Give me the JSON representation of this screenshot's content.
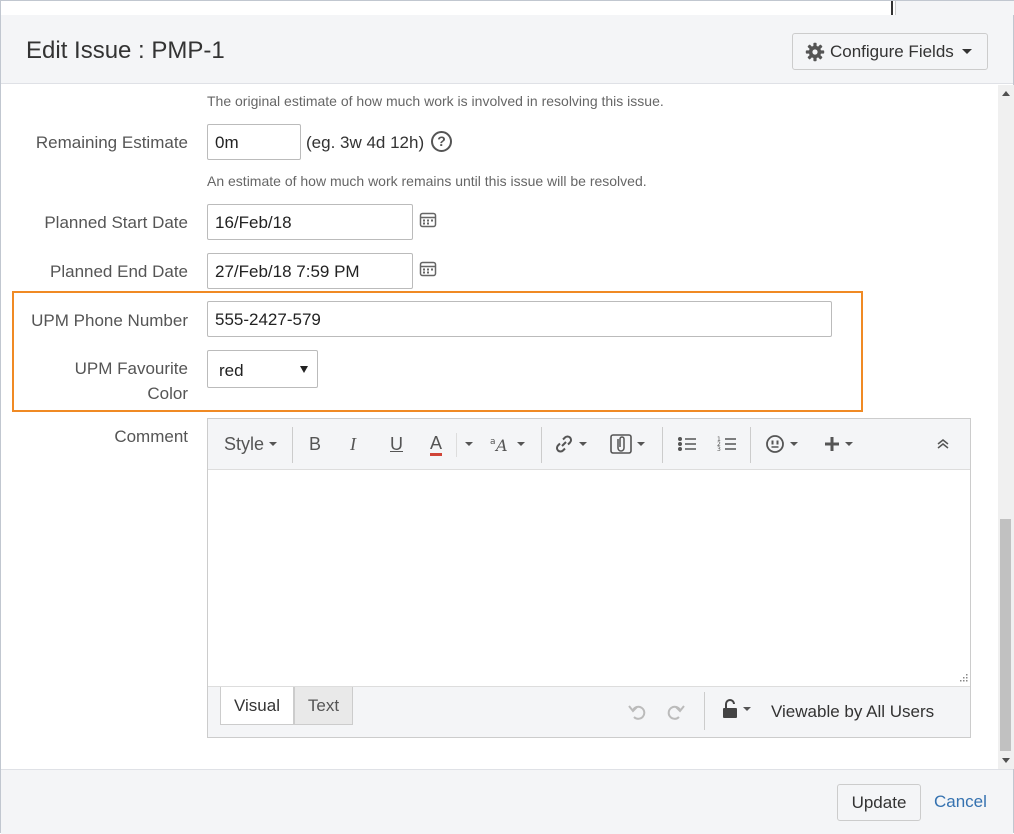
{
  "dialog": {
    "title": "Edit Issue : PMP-1",
    "configure_label": "Configure Fields"
  },
  "fields": {
    "original_estimate_desc": "The original estimate of how much work is involved in resolving this issue.",
    "remaining_estimate": {
      "label": "Remaining Estimate",
      "value": "0m",
      "hint": "(eg. 3w 4d 12h)",
      "help": "?",
      "desc": "An estimate of how much work remains until this issue will be resolved."
    },
    "planned_start": {
      "label": "Planned Start Date",
      "value": "16/Feb/18"
    },
    "planned_end": {
      "label": "Planned End Date",
      "value": "27/Feb/18 7:59 PM"
    },
    "phone": {
      "label": "UPM Phone Number",
      "value": "555-2427-579"
    },
    "color": {
      "label_line1": "UPM Favourite",
      "label_line2": "Color",
      "value": "red"
    },
    "comment": {
      "label": "Comment",
      "style_label": "Style",
      "bold": "B",
      "italic": "I",
      "underline": "U",
      "text_color": "A",
      "mode_visual": "Visual",
      "mode_text": "Text",
      "visibility": "Viewable by All Users"
    }
  },
  "actions": {
    "update_label": "Update",
    "cancel_label": "Cancel"
  },
  "colors": {
    "highlight": "#f08a24",
    "link": "#3572b0",
    "text_color_underline": "#d04437"
  }
}
